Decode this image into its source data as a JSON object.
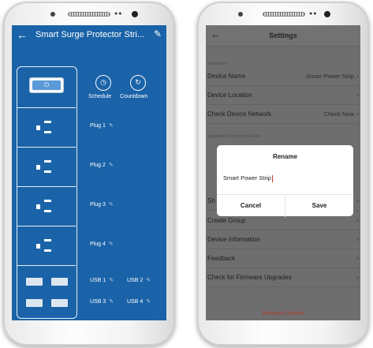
{
  "left_screen": {
    "title": "Smart Surge Protector Stri...",
    "back_icon": "arrow-left-icon",
    "edit_icon": "pencil-icon",
    "power_icon": "power-icon",
    "schedule_label": "Schedule",
    "countdown_label": "Countdown",
    "plugs": [
      "Plug 1",
      "Plug 2",
      "Plug 3",
      "Plug 4"
    ],
    "usb": [
      "USB 1",
      "USB 2",
      "USB 3",
      "USB 4"
    ],
    "colors": {
      "background": "#1a63a8",
      "power_button": "#5a9ad8"
    }
  },
  "right_screen": {
    "title": "Settings",
    "back_icon": "arrow-left-icon",
    "section_information": "Information",
    "section_third_party": "Supported Third-party Control",
    "rows": [
      {
        "label": "Device Name",
        "value": "Smart Power Strip"
      },
      {
        "label": "Device Location",
        "value": ""
      },
      {
        "label": "Check Device Network",
        "value": "Check Now"
      },
      {
        "label": "Sh",
        "value": ""
      },
      {
        "label": "Create Group",
        "value": ""
      },
      {
        "label": "Device Information",
        "value": ""
      },
      {
        "label": "Feedback",
        "value": ""
      },
      {
        "label": "Check for Firmware Upgrades",
        "value": ""
      }
    ],
    "remove_label": "Remove Device",
    "dialog": {
      "title": "Rename",
      "input_value": "Smart Power Strip",
      "cancel_label": "Cancel",
      "save_label": "Save"
    },
    "colors": {
      "overlay": "#6e6e6e",
      "remove": "#b03a2e"
    }
  }
}
